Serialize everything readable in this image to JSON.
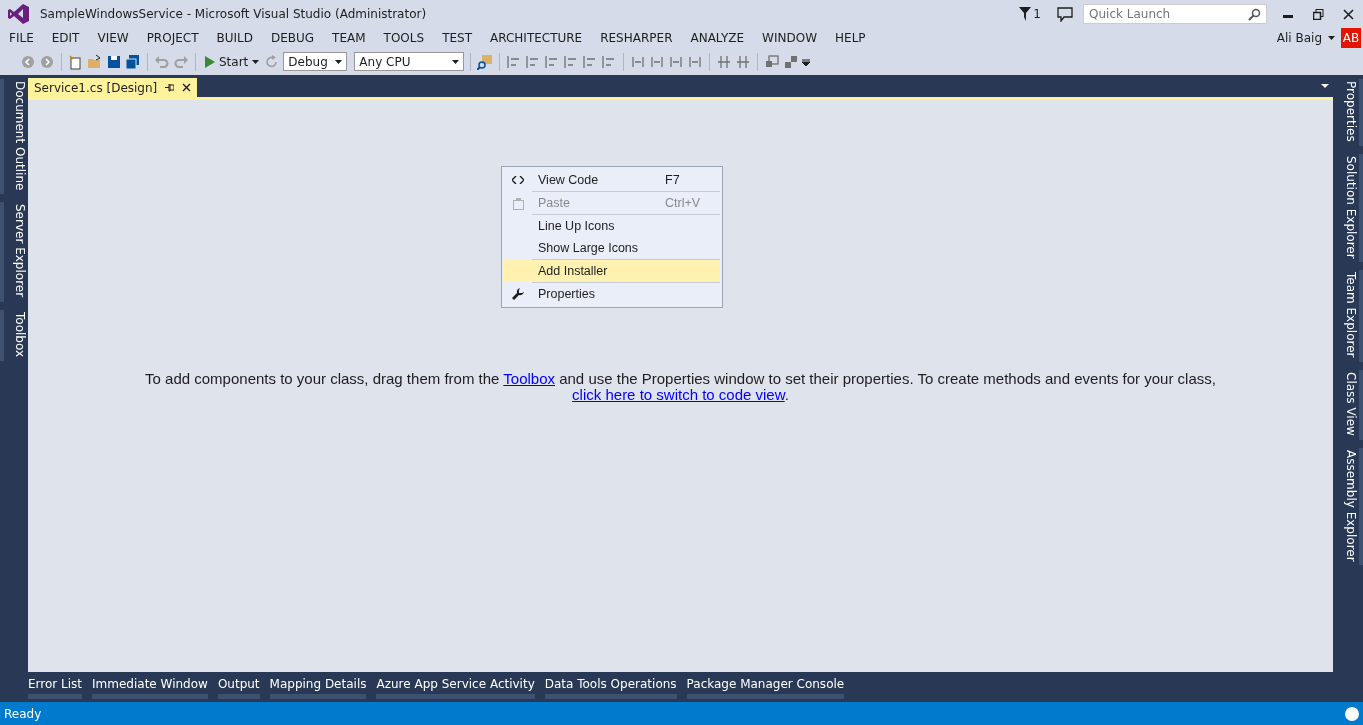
{
  "window": {
    "title": "SampleWindowsService - Microsoft Visual Studio (Administrator)"
  },
  "notifications": {
    "count": "1"
  },
  "quick_launch": {
    "placeholder": "Quick Launch"
  },
  "menu": [
    "FILE",
    "EDIT",
    "VIEW",
    "PROJECT",
    "BUILD",
    "DEBUG",
    "TEAM",
    "TOOLS",
    "TEST",
    "ARCHITECTURE",
    "RESHARPER",
    "ANALYZE",
    "WINDOW",
    "HELP"
  ],
  "user": {
    "name": "Ali Baig",
    "initials": "AB"
  },
  "toolbar": {
    "start": "Start",
    "configuration": "Debug",
    "platform": "Any CPU"
  },
  "left_tabs": [
    "Document Outline",
    "Server Explorer",
    "Toolbox"
  ],
  "right_tabs": [
    "Properties",
    "Solution Explorer",
    "Team Explorer",
    "Class View",
    "Assembly Explorer"
  ],
  "document_tabs": [
    {
      "label": "Service1.cs [Design]",
      "selected": true
    }
  ],
  "designer": {
    "text_1": "To add components to your class, drag them from the ",
    "link_1": "Toolbox",
    "text_2": " and use the Properties window to set their properties. To create methods and events for your class, ",
    "link_2": "click here to switch to code view",
    "text_3": "."
  },
  "context_menu": {
    "groups": [
      [
        {
          "label": "View Code",
          "shortcut": "F7",
          "kind": "code",
          "disabled": false,
          "selected": false
        }
      ],
      [
        {
          "label": "Paste",
          "shortcut": "Ctrl+V",
          "kind": "paste",
          "disabled": true,
          "selected": false
        }
      ],
      [
        {
          "label": "Line Up Icons",
          "kind": "plain",
          "disabled": false,
          "selected": false
        },
        {
          "label": "Show Large Icons",
          "kind": "plain",
          "disabled": false,
          "selected": false
        }
      ],
      [
        {
          "label": "Add Installer",
          "kind": "plain",
          "disabled": false,
          "selected": true
        }
      ],
      [
        {
          "label": "Properties",
          "kind": "wrench",
          "disabled": false,
          "selected": false
        }
      ]
    ]
  },
  "bottom_tabs": [
    "Error List",
    "Immediate Window",
    "Output",
    "Mapping Details",
    "Azure App Service Activity",
    "Data Tools Operations",
    "Package Manager Console"
  ],
  "status_bar": {
    "text": "Ready"
  }
}
